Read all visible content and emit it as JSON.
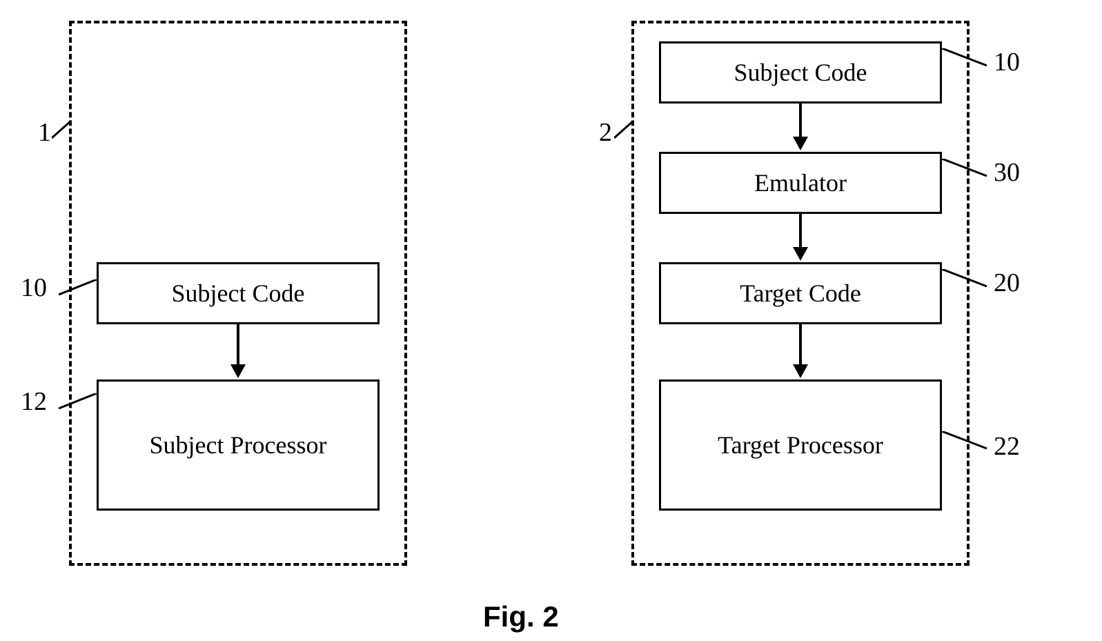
{
  "left": {
    "container_label": "1",
    "boxes": [
      {
        "label": "10",
        "text": "Subject Code"
      },
      {
        "label": "12",
        "text": "Subject Processor"
      }
    ]
  },
  "right": {
    "container_label": "2",
    "boxes": [
      {
        "label": "10",
        "text": "Subject Code"
      },
      {
        "label": "30",
        "text": "Emulator"
      },
      {
        "label": "20",
        "text": "Target Code"
      },
      {
        "label": "22",
        "text": "Target Processor"
      }
    ]
  },
  "caption": "Fig. 2"
}
